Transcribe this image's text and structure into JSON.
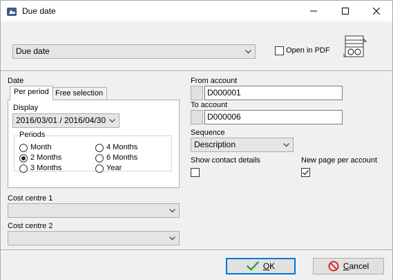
{
  "window": {
    "title": "Due date",
    "controls": {
      "minimize": "minimize-icon",
      "maximize": "maximize-icon",
      "close": "close-icon"
    }
  },
  "report": {
    "selected": "Due date",
    "open_in_pdf_label": "Open in PDF",
    "open_in_pdf_checked": false
  },
  "date_section": {
    "label": "Date",
    "tabs": [
      {
        "label": "Per period",
        "active": true
      },
      {
        "label": "Free selection",
        "active": false
      }
    ],
    "display_label": "Display",
    "display_value": "2016/03/01 / 2016/04/30",
    "periods_label": "Periods",
    "periods": [
      {
        "label": "Month",
        "selected": false
      },
      {
        "label": "2 Months",
        "selected": true
      },
      {
        "label": "3 Months",
        "selected": false
      },
      {
        "label": "4 Months",
        "selected": false
      },
      {
        "label": "6 Months",
        "selected": false
      },
      {
        "label": "Year",
        "selected": false
      }
    ]
  },
  "cost_centre_1": {
    "label": "Cost centre 1",
    "value": ""
  },
  "cost_centre_2": {
    "label": "Cost centre 2",
    "value": ""
  },
  "from_account": {
    "label": "From account",
    "value": "D000001"
  },
  "to_account": {
    "label": "To account",
    "value": "D000006"
  },
  "sequence": {
    "label": "Sequence",
    "value": "Description"
  },
  "show_contact_details": {
    "label": "Show contact details",
    "checked": false
  },
  "new_page_per_account": {
    "label": "New page per account",
    "checked": true
  },
  "buttons": {
    "ok_prefix": "",
    "ok_underlined": "O",
    "ok_rest": "K",
    "cancel_underlined": "C",
    "cancel_rest": "ancel"
  },
  "colors": {
    "accent": "#0078d7",
    "ok_check": "#3aa335",
    "cancel_icon": "#d9262c"
  }
}
